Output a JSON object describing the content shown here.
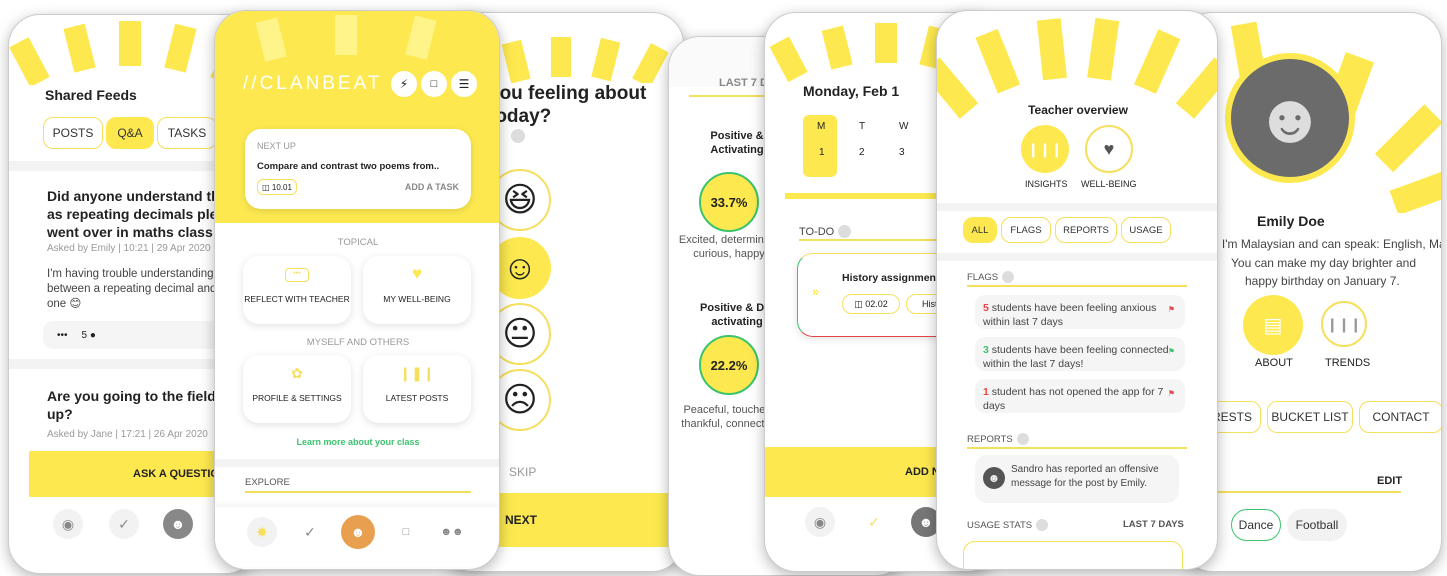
{
  "colors": {
    "accent": "#fde94f",
    "accent_border": "#f6df5c",
    "green": "#3cc36e",
    "red": "#e84545"
  },
  "p1": {
    "title": "Shared Feeds",
    "tabs": [
      "POSTS",
      "Q&A",
      "TASKS"
    ],
    "q1": {
      "title": "Did anyone understand the topic such as repeating decimals please? We went over in maths class",
      "meta": "Asked by Emily | 10:21 | 29 Apr 2020",
      "body": "I'm having trouble understanding the difference between a repeating decimal and a regular one 😊",
      "dots": "•••",
      "count": "5"
    },
    "q2": {
      "title": "Are you going to the field trip coming up?",
      "meta": "Asked by Jane | 17:21 | 26 Apr 2020"
    },
    "ask": "ASK A QUESTION"
  },
  "p2": {
    "logo": "CLANBEAT",
    "next_up": "NEXT UP",
    "next_task": "Compare and contrast two poems from..",
    "date": "10.01",
    "add_task": "ADD A TASK",
    "topical": "TOPICAL",
    "reflect": "REFLECT WITH TEACHER",
    "wellbeing": "MY WELL-BEING",
    "myself": "MYSELF AND OTHERS",
    "profile": "PROFILE & SETTINGS",
    "latest": "LATEST POSTS",
    "learn": "Learn more about your class",
    "explore": "EXPLORE"
  },
  "p3": {
    "q": "you feeling about today?",
    "skip": "SKIP",
    "next": "NEXT"
  },
  "p4": {
    "range": "LAST 7 DAYS",
    "pos_act": "Positive & Activating",
    "pct1": "33.7%",
    "desc1": "Excited, determined, curious, happy",
    "pos_deact": "Positive & De-activating",
    "pct2": "22.2%",
    "desc2": "Peaceful, touched, thankful, connected"
  },
  "p5": {
    "date": "Monday, Feb 1",
    "days": [
      "M",
      "T",
      "W"
    ],
    "nums": [
      "1",
      "2",
      "3"
    ],
    "todo": "TO-DO",
    "task": "History assignment",
    "task_date": "02.02",
    "task_tag": "History",
    "add": "ADD NEW"
  },
  "p6": {
    "title": "Teacher overview",
    "insights": "INSIGHTS",
    "wellbeing": "WELL-BEING",
    "tabs": [
      "ALL",
      "FLAGS",
      "REPORTS",
      "USAGE"
    ],
    "flags_label": "FLAGS",
    "flags": [
      {
        "num": "5",
        "text": " students have been feeling anxious within last 7 days",
        "color": "#e84545"
      },
      {
        "num": "3",
        "text": " students have been feeling connected within the last 7 days!",
        "color": "#3cc36e"
      },
      {
        "num": "1",
        "text": " student has not opened the app for 7 days",
        "color": "#e84545"
      }
    ],
    "reports_label": "REPORTS",
    "report": "Sandro has reported an offensive message for the post by Emily.",
    "usage": "USAGE STATS",
    "range": "LAST 7 DAYS"
  },
  "p7": {
    "name": "Emily Doe",
    "bio1": "I'm Malaysian and can speak: English, Malay",
    "bio2": "You can make my day brighter and",
    "bio3": "happy birthday on January 7.",
    "about": "ABOUT",
    "trends": "TRENDS",
    "tabs": [
      "INTERESTS",
      "BUCKET LIST",
      "CONTACT"
    ],
    "edit": "EDIT",
    "chips": [
      "Dance",
      "Football"
    ]
  }
}
